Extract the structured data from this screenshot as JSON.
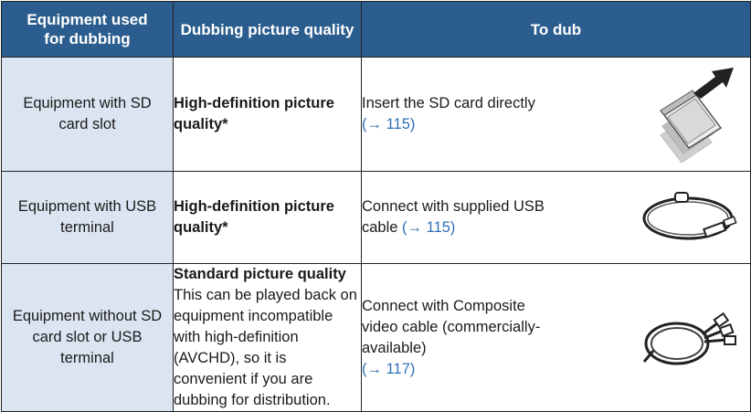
{
  "headers": {
    "equipment": "Equipment used for dubbing",
    "quality": "Dubbing picture quality",
    "todub": "To dub"
  },
  "rows": [
    {
      "equipment": "Equipment with SD card slot",
      "quality_title": "High-definition picture quality*",
      "quality_desc": "",
      "todub_text": "Insert the SD card directly",
      "todub_ref": "(→ 115)",
      "icon": "sd-card-insert-icon"
    },
    {
      "equipment": "Equipment with USB terminal",
      "quality_title": "High-definition picture quality*",
      "quality_desc": "",
      "todub_text": "Connect with supplied USB cable",
      "todub_ref": "(→ 115)",
      "icon": "usb-cable-icon"
    },
    {
      "equipment": "Equipment without SD card slot or USB terminal",
      "quality_title": "Standard picture quality",
      "quality_desc": "This can be played back on equipment incompatible with high-definition (AVCHD), so it is convenient if you are dubbing for distribution.",
      "todub_text": "Connect with Composite video cable (commercially-available)",
      "todub_ref": "(→ 117)",
      "icon": "composite-av-cable-icon"
    }
  ],
  "colors": {
    "header_bg": "#2b5e8e",
    "equip_bg": "#dbe5f1",
    "link": "#2e6fb5"
  }
}
